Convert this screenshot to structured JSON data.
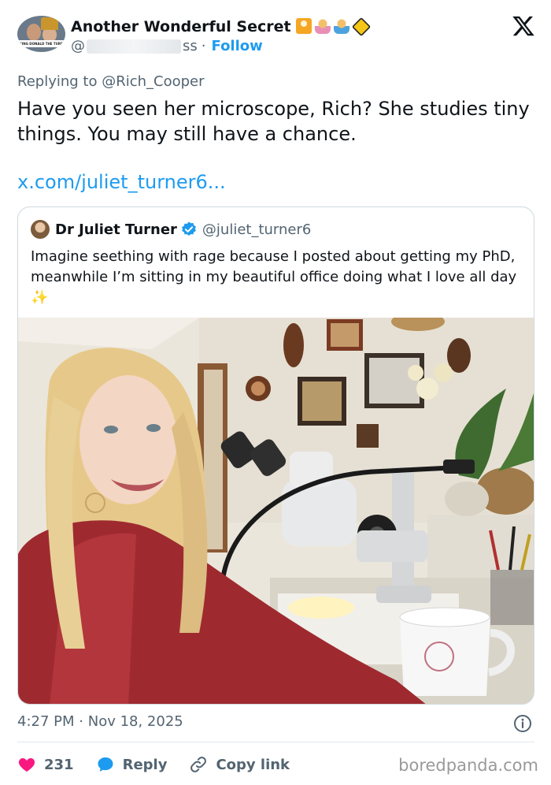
{
  "author": {
    "display_name": "Another Wonderful Secret",
    "handle_prefix": "@",
    "handle_suffix": "ss",
    "separator": "·",
    "follow_label": "Follow",
    "avatar_caption": "KING DONALD THE TURD",
    "emoji_icons": [
      "person-raising-hand-emoji",
      "woman-emoji",
      "man-emoji",
      "children-crossing-emoji"
    ]
  },
  "platform_logo": "x-logo-icon",
  "reply_context": {
    "prefix": "Replying to ",
    "mention": "@Rich_Cooper"
  },
  "tweet": {
    "text": "Have you seen her microscope, Rich?  She studies tiny things.  You may still have a chance.",
    "link": "x.com/juliet_turner6..."
  },
  "quoted_tweet": {
    "name": "Dr Juliet Turner",
    "handle": "@juliet_turner6",
    "verified_icon": "verified-badge-icon",
    "text": "Imagine seething with rage because I posted about getting my PhD, meanwhile I’m sitting in my beautiful office doing what I love all day",
    "emoji": "✨"
  },
  "meta": {
    "time": "4:27 PM",
    "separator": "·",
    "date": "Nov 18, 2025"
  },
  "actions": {
    "like_count": "231",
    "reply_label": "Reply",
    "copy_link_label": "Copy link"
  },
  "watermark": "boredpanda.com",
  "colors": {
    "accent": "#1d9bf0",
    "like": "#f91880",
    "secondary_text": "#536471",
    "border": "#cfd9de"
  }
}
